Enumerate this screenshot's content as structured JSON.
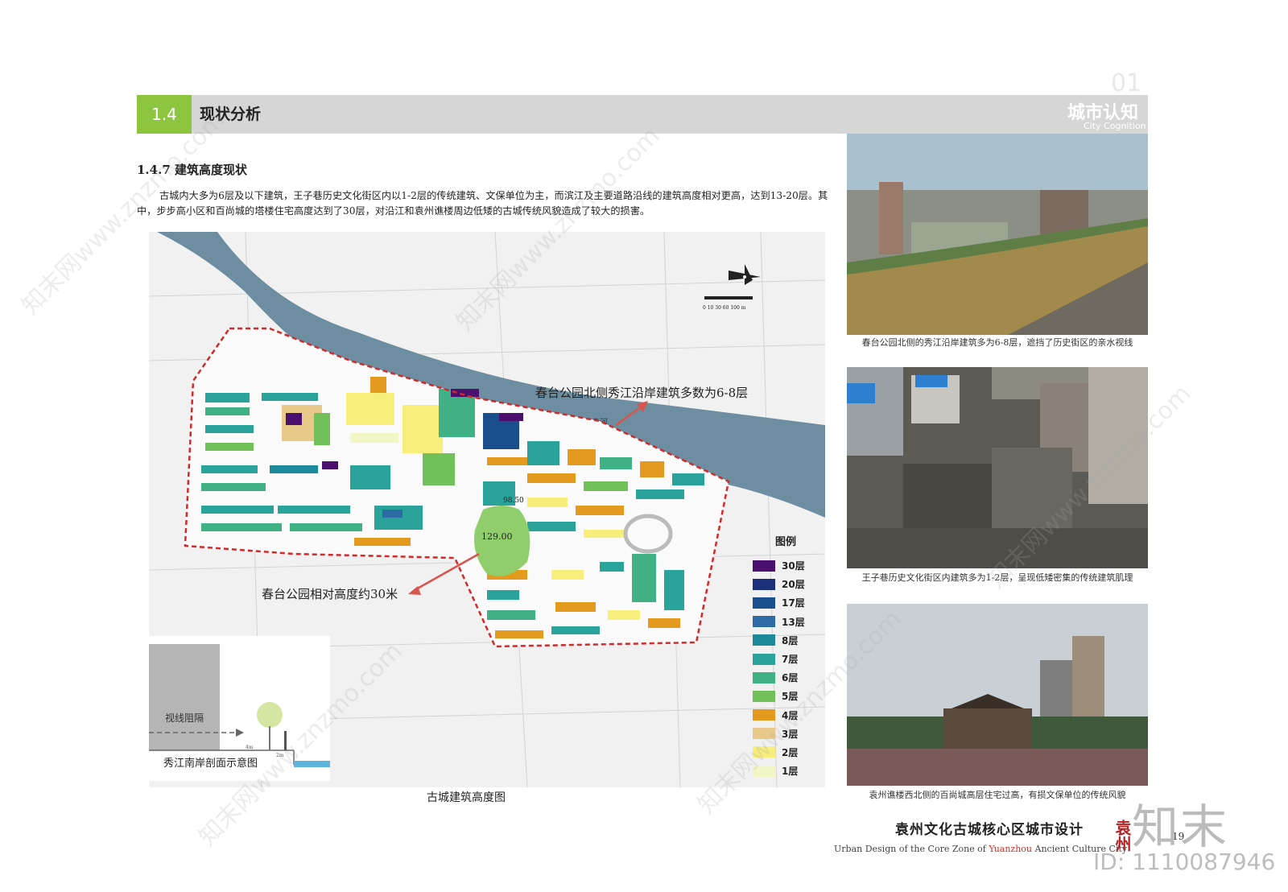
{
  "header": {
    "section_number": "1.4",
    "section_title": "现状分析",
    "chapter_number": "01",
    "chapter_title": "城市认知",
    "chapter_title_en": "City Cognition"
  },
  "subsection_title": "1.4.7 建筑高度现状",
  "intro_text": "古城内大多为6层及以下建筑，王子巷历史文化街区内以1-2层的传统建筑、文保单位为主，而滨江及主要道路沿线的建筑高度相对更高，达到13-20层。其中，步步高小区和百尚城的塔楼住宅高度达到了30层，对沿江和袁州谯楼周边低矮的古城传统风貌造成了较大的损害。",
  "map": {
    "caption": "古城建筑高度图",
    "river_label": "袁河",
    "annotation_north": "春台公园北侧秀江沿岸建筑多数为6-8层",
    "annotation_park": "春台公园相对高度约30米",
    "elevation_park": "129.00",
    "elevation_point": "98.50",
    "scale_text": "0 10 30 60 100 m"
  },
  "legend": {
    "title": "图例",
    "items": [
      {
        "label": "30层",
        "color": "#4b0f6e"
      },
      {
        "label": "20层",
        "color": "#1b2f7a"
      },
      {
        "label": "17层",
        "color": "#1a4e8c"
      },
      {
        "label": "13层",
        "color": "#2e6aa6"
      },
      {
        "label": "8层",
        "color": "#1d8a9b"
      },
      {
        "label": "7层",
        "color": "#2aa39a"
      },
      {
        "label": "6层",
        "color": "#3fb185"
      },
      {
        "label": "5层",
        "color": "#72c05a"
      },
      {
        "label": "4层",
        "color": "#e39a1f"
      },
      {
        "label": "3层",
        "color": "#e8c98a"
      },
      {
        "label": "2层",
        "color": "#f7ee7c"
      },
      {
        "label": "1层",
        "color": "#f2f5c6"
      }
    ]
  },
  "section_diagram": {
    "label": "视线阻隔",
    "caption": "秀江南岸剖面示意图",
    "dim_a": "4m",
    "dim_b": "2m"
  },
  "photos": [
    {
      "caption": "春台公园北侧的秀江沿岸建筑多为6-8层，遮挡了历史街区的亲水视线"
    },
    {
      "caption": "王子巷历史文化街区内建筑多为1-2层，呈现低矮密集的传统建筑肌理"
    },
    {
      "caption": "袁州谯楼西北侧的百尚城高层住宅过高，有损文保单位的传统风貌"
    }
  ],
  "footer": {
    "title": "袁州文化古城核心区城市设计",
    "en_prefix": "Urban Design of the Core Zone of",
    "en_highlight": "Yuanzhou",
    "en_suffix": "Ancient Culture City",
    "seal": "袁州",
    "page": "19"
  },
  "watermark": {
    "brand": "知末",
    "id": "ID: 1110087946",
    "diagonal": "知末网www.znzmo.com"
  }
}
